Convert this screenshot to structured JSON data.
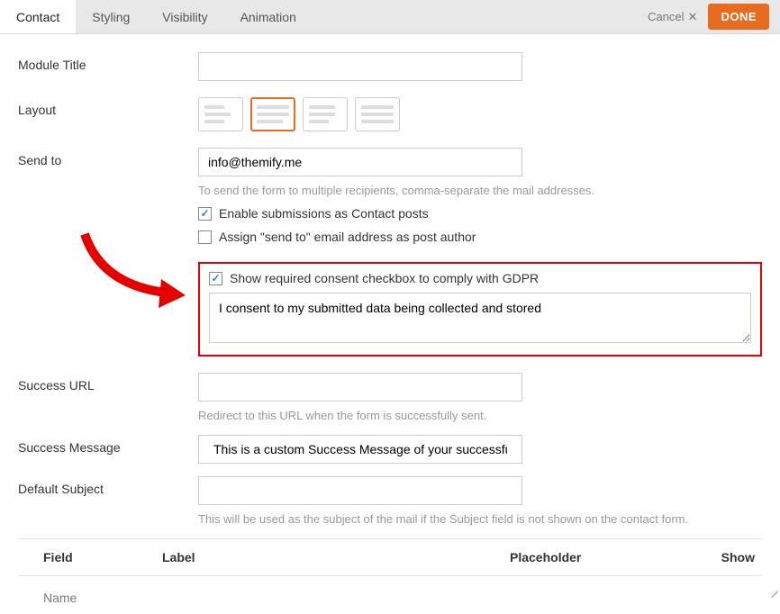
{
  "tabs": [
    "Contact",
    "Styling",
    "Visibility",
    "Animation"
  ],
  "active_tab": 0,
  "actions": {
    "cancel": "Cancel",
    "done": "DONE"
  },
  "fields": {
    "module_title": {
      "label": "Module Title",
      "value": ""
    },
    "layout": {
      "label": "Layout"
    },
    "send_to": {
      "label": "Send to",
      "value": "info@themify.me",
      "hint": "To send the form to multiple recipients, comma-separate the mail addresses."
    },
    "enable_submissions": {
      "checked": true,
      "label": "Enable submissions as Contact posts"
    },
    "assign_send_to": {
      "checked": false,
      "label": "Assign \"send to\" email address as post author"
    },
    "gdpr": {
      "checked": true,
      "label": "Show required consent checkbox to comply with GDPR",
      "text": "I consent to my submitted data being collected and stored"
    },
    "success_url": {
      "label": "Success URL",
      "value": "",
      "hint": "Redirect to this URL when the form is successfully sent."
    },
    "success_message": {
      "label": "Success Message",
      "value": "This is a custom Success Message of your successfully s"
    },
    "default_subject": {
      "label": "Default Subject",
      "value": "",
      "hint": "This will be used as the subject of the mail if the Subject field is not shown on the contact form."
    }
  },
  "table": {
    "headers": {
      "field": "Field",
      "label": "Label",
      "placeholder": "Placeholder",
      "show": "Show"
    },
    "rows": [
      {
        "field": "Name"
      }
    ]
  }
}
